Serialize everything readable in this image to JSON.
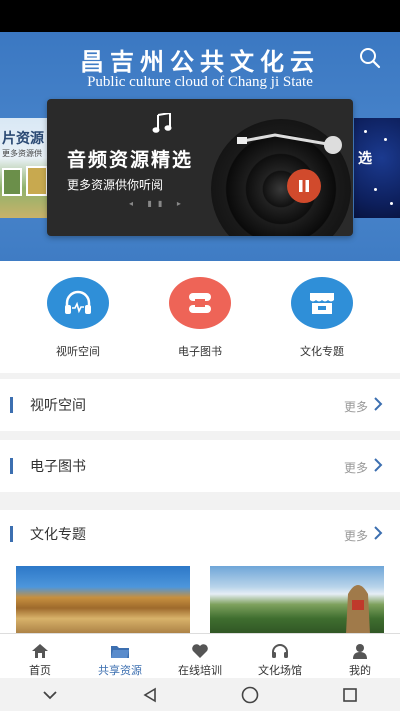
{
  "header": {
    "title": "昌吉州公共文化云",
    "subtitle": "Public culture cloud of Chang ji State"
  },
  "banner": {
    "title": "音频资源精选",
    "subtitle": "更多资源供你听阅",
    "left_card_label": "片资源",
    "left_card_sub": "更多资源供",
    "right_card_label": "选"
  },
  "quick_nav": [
    {
      "label": "视听空间",
      "color": "#2f8fd8",
      "icon": "headphones-icon"
    },
    {
      "label": "电子图书",
      "color": "#ee6457",
      "icon": "book-icon"
    },
    {
      "label": "文化专题",
      "color": "#2f8fd8",
      "icon": "store-icon"
    }
  ],
  "sections": {
    "audio": {
      "title": "视听空间",
      "more": "更多"
    },
    "ebook": {
      "title": "电子图书",
      "more": "更多"
    },
    "culture": {
      "title": "文化专题",
      "more": "更多"
    }
  },
  "tabs": [
    {
      "label": "首页",
      "icon": "home-icon"
    },
    {
      "label": "共享资源",
      "icon": "folder-icon",
      "active": true
    },
    {
      "label": "在线培训",
      "icon": "heart-icon"
    },
    {
      "label": "文化场馆",
      "icon": "headset-icon"
    },
    {
      "label": "我的",
      "icon": "user-icon"
    }
  ],
  "colors": {
    "accent": "#3c6fb0",
    "header_bg": "#4a86cc",
    "play_button": "#d14a2c"
  }
}
